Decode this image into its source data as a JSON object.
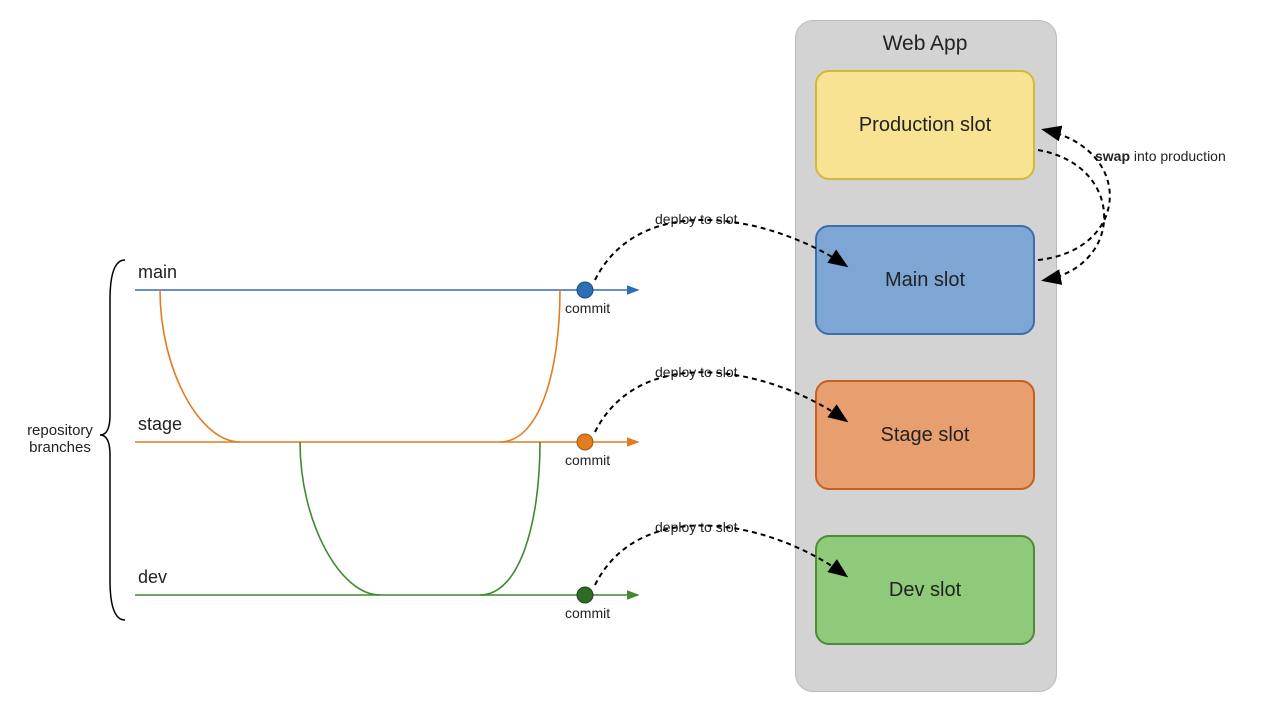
{
  "title": "Web App",
  "slots": {
    "production": {
      "label": "Production slot",
      "fill": "#F7E391",
      "stroke": "#D4B83E"
    },
    "main": {
      "label": "Main slot",
      "fill": "#7EA6D4",
      "stroke": "#3A6FA8"
    },
    "stage": {
      "label": "Stage slot",
      "fill": "#E89F6F",
      "stroke": "#C95F1E"
    },
    "dev": {
      "label": "Dev slot",
      "fill": "#8FC97A",
      "stroke": "#4E8A38"
    }
  },
  "branches": {
    "main": {
      "label": "main",
      "color": "#2E6FB4",
      "commit_label": "commit"
    },
    "stage": {
      "label": "stage",
      "color": "#E27D1F",
      "commit_label": "commit"
    },
    "dev": {
      "label": "dev",
      "color": "#3F8A2F",
      "commit_label": "commit"
    }
  },
  "side_label": "repository\nbranches",
  "deploy_label": "deploy to slot",
  "swap_label_bold": "swap",
  "swap_label_rest": " into\nproduction"
}
